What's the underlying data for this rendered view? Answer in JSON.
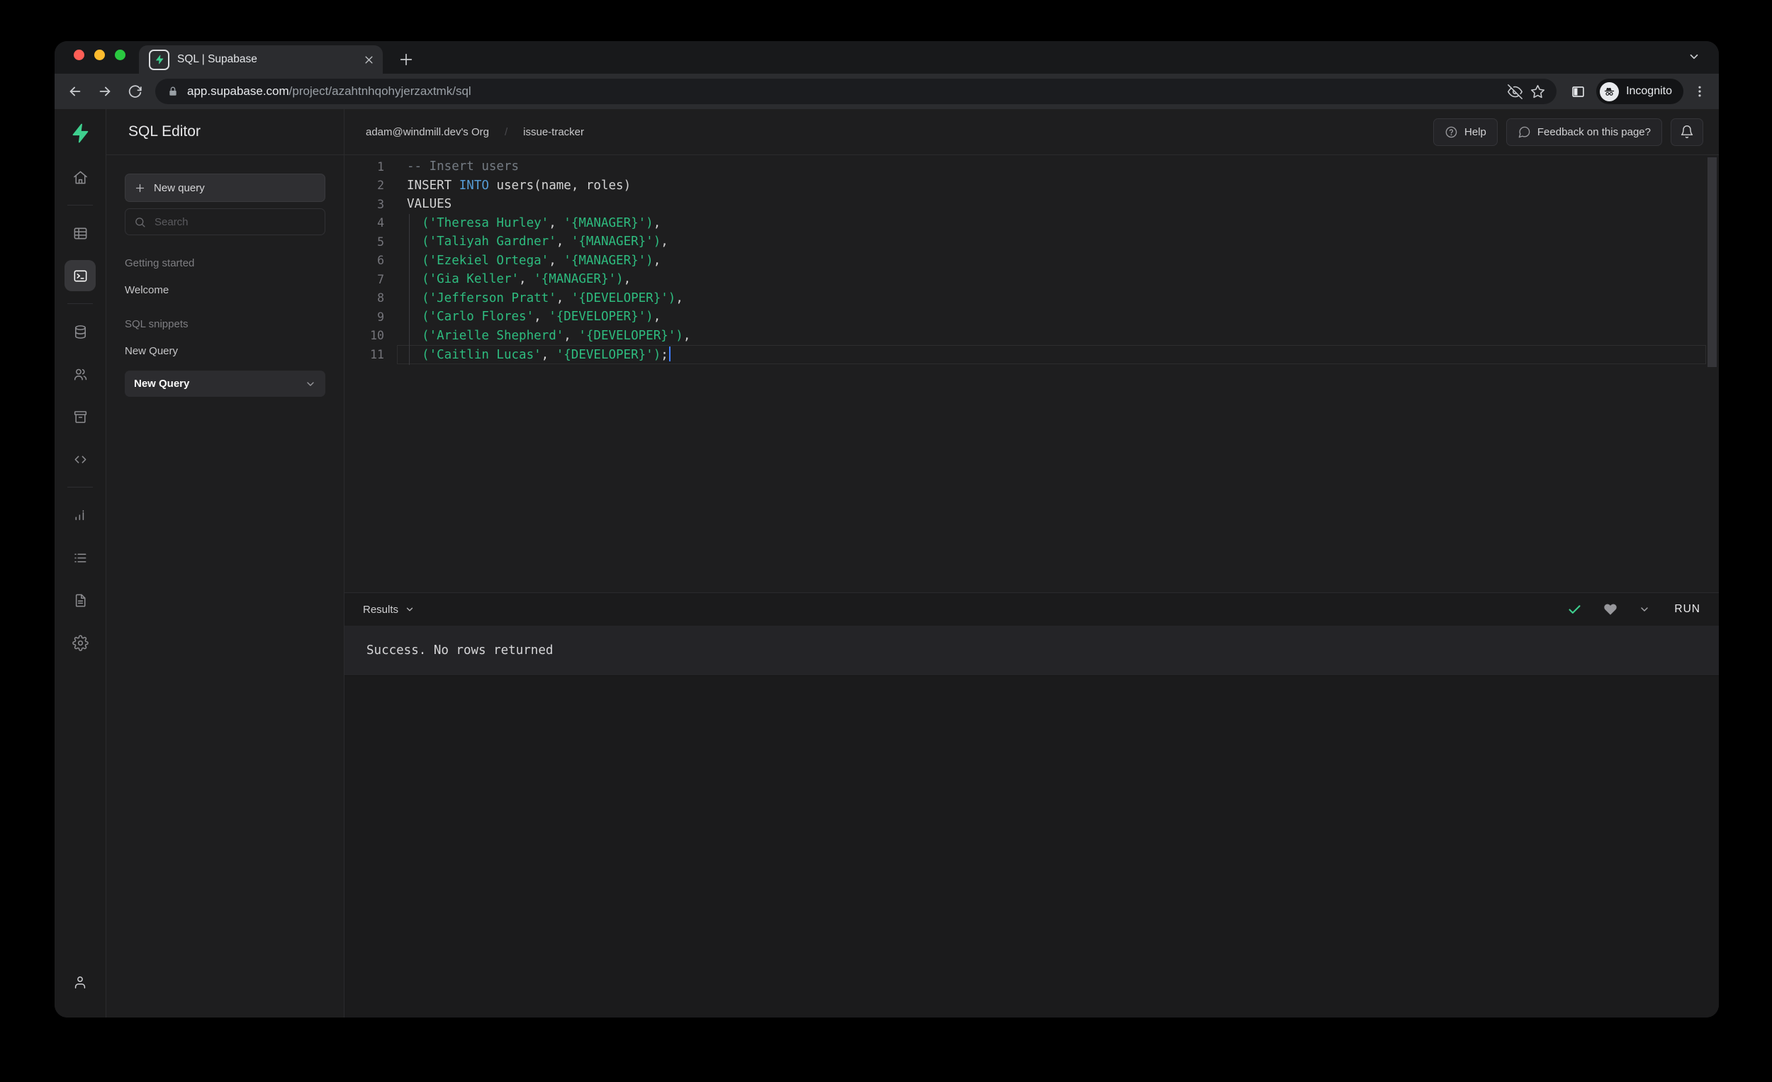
{
  "browser": {
    "tab": {
      "title": "SQL | Supabase"
    },
    "url": {
      "domain": "app.supabase.com",
      "path": "/project/azahtnhqohyjerzaxtmk/sql"
    },
    "incognito_label": "Incognito"
  },
  "header": {
    "breadcrumb": {
      "org": "adam@windmill.dev's Org",
      "separator": "/",
      "project": "issue-tracker"
    },
    "help_label": "Help",
    "feedback_label": "Feedback on this page?"
  },
  "sidebar_panel": {
    "title": "SQL Editor",
    "new_query_button": "New query",
    "search_placeholder": "Search",
    "sections": [
      {
        "label": "Getting started",
        "items": [
          {
            "label": "Welcome",
            "active": false
          }
        ]
      },
      {
        "label": "SQL snippets",
        "items": [
          {
            "label": "New Query",
            "active": false
          },
          {
            "label": "New Query",
            "active": true
          }
        ]
      }
    ]
  },
  "rail": {
    "items": [
      {
        "icon": "home"
      },
      {
        "divider": true
      },
      {
        "icon": "table-editor"
      },
      {
        "icon": "sql-editor",
        "active": true
      },
      {
        "divider": true
      },
      {
        "icon": "database"
      },
      {
        "icon": "auth"
      },
      {
        "icon": "storage"
      },
      {
        "icon": "functions"
      },
      {
        "divider": true
      },
      {
        "icon": "reports"
      },
      {
        "icon": "logs"
      },
      {
        "icon": "api-docs"
      },
      {
        "icon": "settings"
      }
    ]
  },
  "editor": {
    "lines": [
      {
        "tokens": [
          {
            "c": "cm",
            "t": "-- Insert users"
          }
        ]
      },
      {
        "tokens": [
          {
            "c": "pl",
            "t": "INSERT "
          },
          {
            "c": "kw",
            "t": "INTO"
          },
          {
            "c": "pl",
            "t": " users(name, roles)"
          }
        ]
      },
      {
        "tokens": [
          {
            "c": "pl",
            "t": "VALUES"
          }
        ]
      },
      {
        "tokens": [
          {
            "c": "pl",
            "t": "  "
          },
          {
            "c": "st",
            "t": "('Theresa Hurley'"
          },
          {
            "c": "pl",
            "t": ", "
          },
          {
            "c": "st",
            "t": "'{MANAGER}')"
          },
          {
            "c": "pl",
            "t": ","
          }
        ],
        "guide": true
      },
      {
        "tokens": [
          {
            "c": "pl",
            "t": "  "
          },
          {
            "c": "st",
            "t": "('Taliyah Gardner'"
          },
          {
            "c": "pl",
            "t": ", "
          },
          {
            "c": "st",
            "t": "'{MANAGER}')"
          },
          {
            "c": "pl",
            "t": ","
          }
        ],
        "guide": true
      },
      {
        "tokens": [
          {
            "c": "pl",
            "t": "  "
          },
          {
            "c": "st",
            "t": "('Ezekiel Ortega'"
          },
          {
            "c": "pl",
            "t": ", "
          },
          {
            "c": "st",
            "t": "'{MANAGER}')"
          },
          {
            "c": "pl",
            "t": ","
          }
        ],
        "guide": true
      },
      {
        "tokens": [
          {
            "c": "pl",
            "t": "  "
          },
          {
            "c": "st",
            "t": "('Gia Keller'"
          },
          {
            "c": "pl",
            "t": ", "
          },
          {
            "c": "st",
            "t": "'{MANAGER}')"
          },
          {
            "c": "pl",
            "t": ","
          }
        ],
        "guide": true
      },
      {
        "tokens": [
          {
            "c": "pl",
            "t": "  "
          },
          {
            "c": "st",
            "t": "('Jefferson Pratt'"
          },
          {
            "c": "pl",
            "t": ", "
          },
          {
            "c": "st",
            "t": "'{DEVELOPER}')"
          },
          {
            "c": "pl",
            "t": ","
          }
        ],
        "guide": true
      },
      {
        "tokens": [
          {
            "c": "pl",
            "t": "  "
          },
          {
            "c": "st",
            "t": "('Carlo Flores'"
          },
          {
            "c": "pl",
            "t": ", "
          },
          {
            "c": "st",
            "t": "'{DEVELOPER}')"
          },
          {
            "c": "pl",
            "t": ","
          }
        ],
        "guide": true
      },
      {
        "tokens": [
          {
            "c": "pl",
            "t": "  "
          },
          {
            "c": "st",
            "t": "('Arielle Shepherd'"
          },
          {
            "c": "pl",
            "t": ", "
          },
          {
            "c": "st",
            "t": "'{DEVELOPER}')"
          },
          {
            "c": "pl",
            "t": ","
          }
        ],
        "guide": true
      },
      {
        "tokens": [
          {
            "c": "pl",
            "t": "  "
          },
          {
            "c": "st",
            "t": "('Caitlin Lucas'"
          },
          {
            "c": "pl",
            "t": ", "
          },
          {
            "c": "st",
            "t": "'{DEVELOPER}')"
          },
          {
            "c": "pl",
            "t": ";"
          }
        ],
        "guide": true,
        "current": true,
        "cursor": true
      }
    ]
  },
  "results": {
    "label": "Results",
    "run_label": "RUN",
    "message": "Success. No rows returned"
  },
  "colors": {
    "accent_green": "#3ecf8e",
    "string_green": "#2ebc7f",
    "keyword_blue": "#569cd6",
    "cursor_blue": "#3e7eff",
    "success_check": "#3ecf8e"
  }
}
